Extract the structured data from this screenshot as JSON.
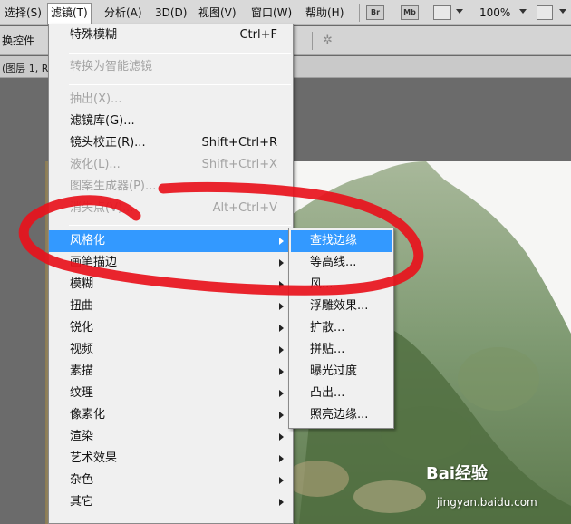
{
  "menubar": {
    "items": [
      {
        "label": "选择(S)"
      },
      {
        "label": "滤镜(T)",
        "active": true
      },
      {
        "label": "分析(A)"
      },
      {
        "label": "3D(D)"
      },
      {
        "label": "视图(V)"
      },
      {
        "label": "窗口(W)"
      },
      {
        "label": "帮助(H)"
      }
    ],
    "icon_br": "Br",
    "icon_mb": "Mb",
    "zoom": "100%"
  },
  "options_bar": {
    "label": "换控件"
  },
  "doc_tab": {
    "label": "(图层 1, R"
  },
  "filter_menu": {
    "items": [
      {
        "label": "特殊模糊",
        "shortcut": "Ctrl+F",
        "disabled": false
      },
      {
        "label": "转换为智能滤镜",
        "shortcut": "",
        "disabled": true
      },
      {
        "label": "抽出(X)...",
        "shortcut": "",
        "disabled": true
      },
      {
        "label": "滤镜库(G)...",
        "shortcut": "",
        "disabled": false
      },
      {
        "label": "镜头校正(R)...",
        "shortcut": "Shift+Ctrl+R",
        "disabled": false
      },
      {
        "label": "液化(L)...",
        "shortcut": "Shift+Ctrl+X",
        "disabled": true
      },
      {
        "label": "图案生成器(P)...",
        "shortcut": "",
        "disabled": true
      },
      {
        "label": "消失点(V)...",
        "shortcut": "Alt+Ctrl+V",
        "disabled": true
      },
      {
        "label": "风格化",
        "submenu": true,
        "highlighted": true
      },
      {
        "label": "画笔描边",
        "submenu": true
      },
      {
        "label": "模糊",
        "submenu": true
      },
      {
        "label": "扭曲",
        "submenu": true
      },
      {
        "label": "锐化",
        "submenu": true
      },
      {
        "label": "视频",
        "submenu": true
      },
      {
        "label": "素描",
        "submenu": true
      },
      {
        "label": "纹理",
        "submenu": true
      },
      {
        "label": "像素化",
        "submenu": true
      },
      {
        "label": "渲染",
        "submenu": true
      },
      {
        "label": "艺术效果",
        "submenu": true
      },
      {
        "label": "杂色",
        "submenu": true
      },
      {
        "label": "其它",
        "submenu": true
      }
    ]
  },
  "stylize_submenu": {
    "items": [
      {
        "label": "查找边缘",
        "highlighted": true
      },
      {
        "label": "等高线..."
      },
      {
        "label": "风..."
      },
      {
        "label": "浮雕效果..."
      },
      {
        "label": "扩散..."
      },
      {
        "label": "拼贴..."
      },
      {
        "label": "曝光过度"
      },
      {
        "label": "凸出..."
      },
      {
        "label": "照亮边缘..."
      }
    ]
  },
  "watermark": {
    "brand": "Bai经验",
    "url": "jingyan.baidu.com"
  },
  "colors": {
    "highlight": "#3399ff",
    "annotation": "#e8121c"
  }
}
